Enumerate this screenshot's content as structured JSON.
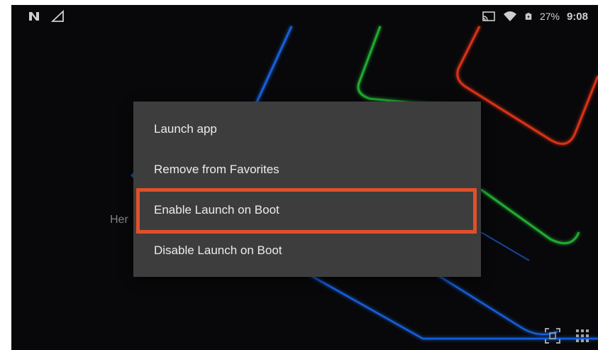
{
  "status_bar": {
    "left_icons": [
      "notification-n-icon",
      "signal-triangle-icon"
    ],
    "right_icons": [
      "cast-icon",
      "wifi-icon",
      "battery-icon"
    ],
    "battery_percent": "27%",
    "time": "9:08"
  },
  "home": {
    "partial_label": "Her"
  },
  "context_menu": {
    "items": [
      {
        "label": "Launch app"
      },
      {
        "label": "Remove from Favorites"
      },
      {
        "label": "Enable Launch on Boot",
        "highlighted": true
      },
      {
        "label": "Disable Launch on Boot"
      }
    ]
  },
  "bottom_bar": {
    "icons": [
      "screenshot-frame-icon",
      "app-grid-icon"
    ]
  },
  "colors": {
    "menu_background": "#3d3d3d",
    "highlight_border": "#e0502a",
    "wallpaper_blue": "#1f6fff",
    "wallpaper_green": "#26c93a",
    "wallpaper_red": "#ff3b1a"
  }
}
